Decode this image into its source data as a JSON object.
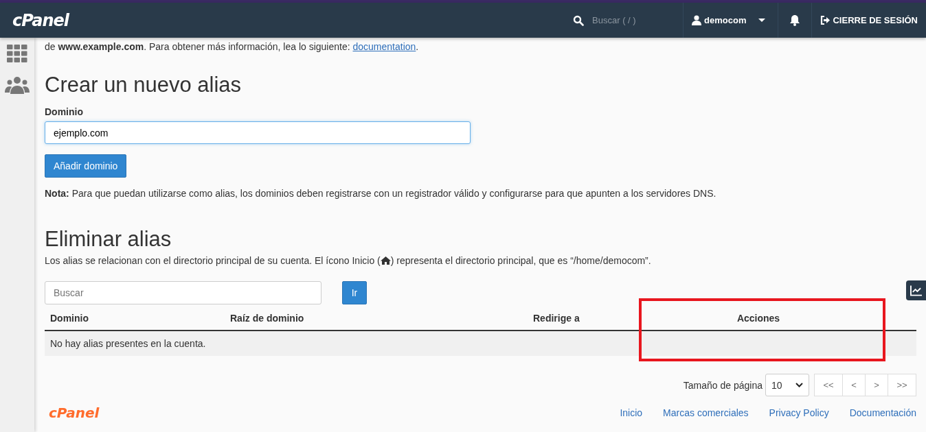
{
  "header": {
    "logo": "cPanel",
    "search_placeholder": "Buscar ( / )",
    "user": "democom",
    "logout": "CIERRE DE SESIÓN"
  },
  "intro": "de **www.example.com**. Para obtener más información, lea lo siguiente: ",
  "intro_link": "documentation",
  "intro_end": ".",
  "create": {
    "title": "Crear un nuevo alias",
    "label": "Dominio",
    "value": "ejemplo.com",
    "button": "Añadir dominio",
    "note": "**Nota:** Para que puedan utilizarse como alias, los dominios deben registrarse con un registrador válido y configurarse para que apunten a los servidores DNS."
  },
  "remove": {
    "title": "Eliminar alias",
    "desc_before": "Los alias se relacionan con el directorio principal de su cuenta. El ícono Inicio (",
    "desc_after": ") representa el directorio principal, que es “/home/democom”.",
    "search_placeholder": "Buscar",
    "go": "Ir"
  },
  "table": {
    "columns": [
      "Dominio",
      "Raíz de dominio",
      "Redirige a",
      "Acciones"
    ],
    "empty": "No hay alias presentes en la cuenta."
  },
  "pagination": {
    "label": "Tamaño de página",
    "page_size": "10",
    "buttons": [
      "<<",
      "<",
      ">",
      ">>"
    ]
  },
  "footer": {
    "logo": "cPanel",
    "links": [
      "Inicio",
      "Marcas comerciales",
      "Privacy Policy",
      "Documentación"
    ]
  }
}
